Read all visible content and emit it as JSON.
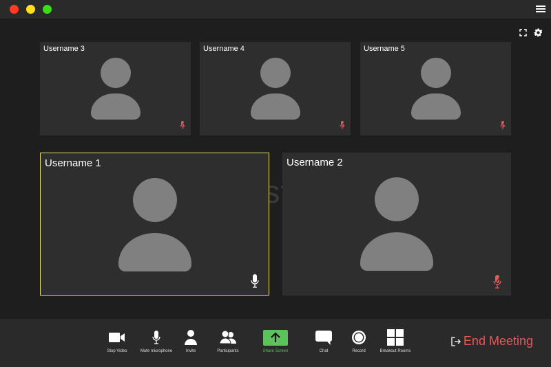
{
  "window": {
    "controls": [
      {
        "name": "close",
        "color": "#ff3b22"
      },
      {
        "name": "minimize",
        "color": "#ffe11a"
      },
      {
        "name": "maximize",
        "color": "#3ddb1a"
      }
    ]
  },
  "participants": [
    {
      "name": "Username 3",
      "muted": true
    },
    {
      "name": "Username 4",
      "muted": true
    },
    {
      "name": "Username 5",
      "muted": true
    },
    {
      "name": "Username 1",
      "muted": false,
      "active": true
    },
    {
      "name": "Username 2",
      "muted": true
    }
  ],
  "toolbar": {
    "items": [
      {
        "label": "Stop Video",
        "icon": "video-camera-icon"
      },
      {
        "label": "Mute microphone",
        "icon": "microphone-icon"
      },
      {
        "label": "Invite",
        "icon": "person-icon"
      },
      {
        "label": "Participants",
        "icon": "people-icon"
      },
      {
        "label": "Share Screen",
        "icon": "share-screen-icon"
      },
      {
        "label": "Chat",
        "icon": "chat-icon"
      },
      {
        "label": "Record",
        "icon": "record-icon"
      },
      {
        "label": "Breakout Rooms",
        "icon": "grid-icon"
      }
    ],
    "end_meeting": "End Meeting"
  },
  "colors": {
    "accent_green": "#5cc25c",
    "end_red": "#e05a5a",
    "muted_red": "#e05a5a",
    "active_border": "#e8e36a"
  },
  "watermark": "dreamstime"
}
